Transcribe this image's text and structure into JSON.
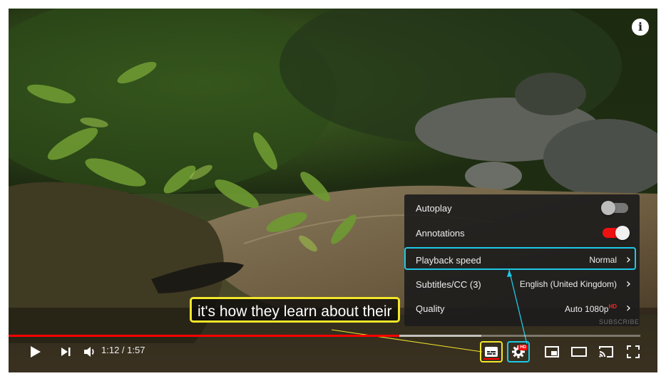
{
  "player": {
    "info_icon": "info-icon",
    "caption_text": "it's how they learn about their",
    "watermark": "SUBSCRIBE",
    "progress": {
      "played_fraction": 0.619,
      "buffered_fraction": 0.13
    },
    "time": "1:12 / 1:57"
  },
  "settings_menu": {
    "autoplay": {
      "label": "Autoplay",
      "on": false
    },
    "annotations": {
      "label": "Annotations",
      "on": true
    },
    "playback_speed": {
      "label": "Playback speed",
      "value": "Normal"
    },
    "subtitles": {
      "label": "Subtitles/CC (3)",
      "value": "English (United Kingdom)"
    },
    "quality": {
      "label": "Quality",
      "value": "Auto 1080p",
      "badge": "HD"
    }
  },
  "controls": {
    "play": "play-icon",
    "next": "next-icon",
    "volume": "volume-icon",
    "cc": "subtitles-icon",
    "settings": "gear-icon",
    "settings_badge": "HD",
    "miniplayer": "miniplayer-icon",
    "theater": "theater-mode-icon",
    "cast": "cast-icon",
    "fullscreen": "fullscreen-icon"
  },
  "colors": {
    "progress_played": "#ff0000",
    "toggle_on": "#ee1111",
    "highlight_cyan": "#1ec8e6",
    "highlight_yellow": "#f2e62a"
  }
}
